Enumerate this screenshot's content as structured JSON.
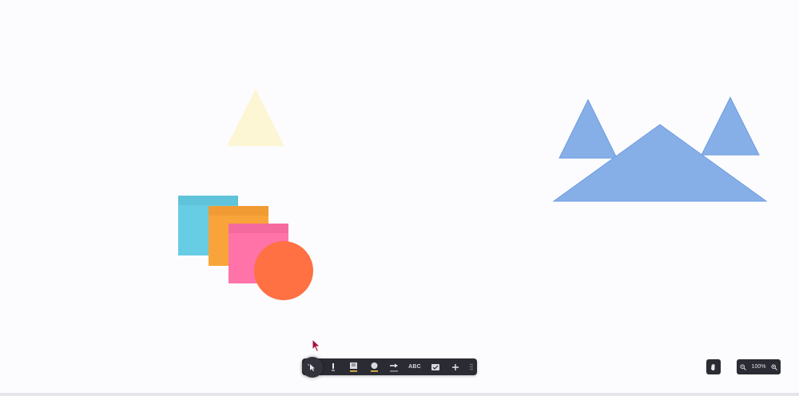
{
  "zoom": {
    "value": "100%"
  },
  "toolbar": {
    "text_tool_label": "ABC",
    "tools": [
      "select",
      "pen",
      "sticky-note",
      "shape",
      "connector",
      "text",
      "template",
      "add",
      "more"
    ]
  },
  "colors": {
    "background": "#fcfcfe",
    "toolbar": "#2b2b33",
    "triangle_yellow": "#fdf6d4",
    "triangle_blue": "#86afe8",
    "triangle_blue_stroke": "#6e9ce0",
    "note_cyan": "#66cde4",
    "note_orange": "#f9a43a",
    "note_pink": "#ff73a8",
    "circle": "#ff7043",
    "cursor": "#a3123f"
  }
}
